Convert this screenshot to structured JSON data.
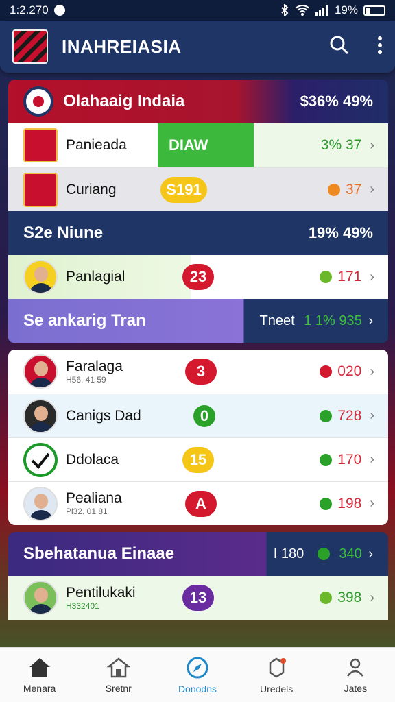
{
  "status_bar": {
    "time": "1:2.270",
    "battery": "19%"
  },
  "app_bar": {
    "title": "INAHREIASIA"
  },
  "section1": {
    "title": "Olahaaig Indaia",
    "value": "$36% 49%",
    "rows": [
      {
        "name": "Panieada",
        "badge": "DIAW",
        "value": "3% 37"
      },
      {
        "name": "Curiang",
        "badge": "S191",
        "value": "37"
      }
    ]
  },
  "section2": {
    "title": "S2e Niune",
    "value": "19% 49%",
    "rows": [
      {
        "name": "Panlagial",
        "badge": "23",
        "value": "171"
      }
    ]
  },
  "section3": {
    "title": "Se ankarig Tran",
    "value_label": "Tneet",
    "value": "1 1% 935"
  },
  "section3_rows": [
    {
      "name": "Faralaga",
      "sub": "H56. 41 59",
      "badge": "3",
      "value": "020"
    },
    {
      "name": "Canigs Dad",
      "sub": "",
      "badge": "0",
      "value": "728"
    },
    {
      "name": "Ddolaca",
      "sub": "",
      "badge": "15",
      "value": "170"
    },
    {
      "name": "Pealiana",
      "sub": "Pl32. 01 81",
      "badge": "A",
      "value": "198"
    }
  ],
  "section4": {
    "title": "Sbehatanua Einaae",
    "value_label": "I 180",
    "value": "340",
    "rows": [
      {
        "name": "Pentilukaki",
        "sub": "H332401",
        "badge": "13",
        "value": "398"
      }
    ]
  },
  "bottom_nav": [
    {
      "label": "Menara"
    },
    {
      "label": "Sretnr"
    },
    {
      "label": "Donodns"
    },
    {
      "label": "Uredels"
    },
    {
      "label": "Jates"
    }
  ]
}
